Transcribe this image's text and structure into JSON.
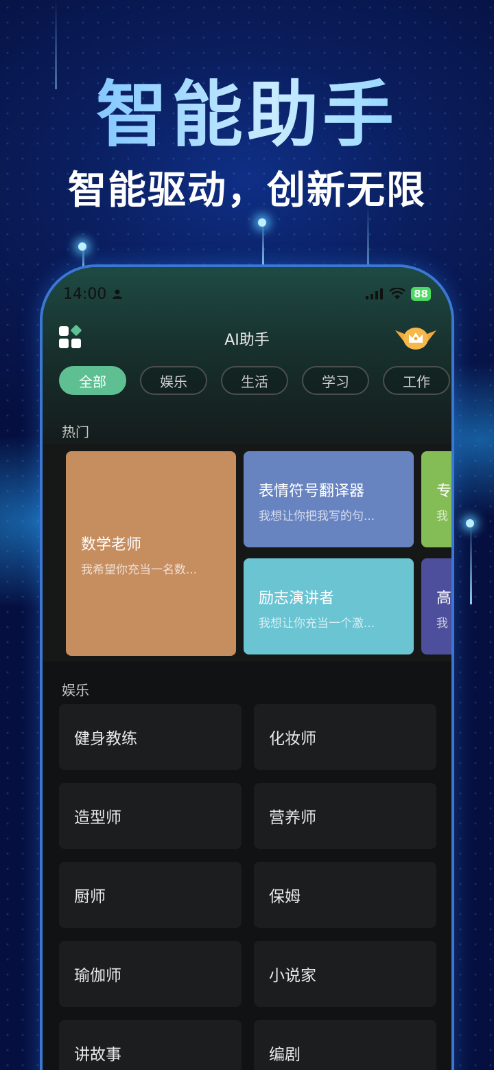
{
  "hero": {
    "title": "智能助手",
    "subtitle": "智能驱动，创新无限"
  },
  "status_bar": {
    "time": "14:00",
    "battery": "88"
  },
  "app": {
    "title": "AI助手"
  },
  "tabs": [
    {
      "label": "全部",
      "active": true
    },
    {
      "label": "娱乐"
    },
    {
      "label": "生活"
    },
    {
      "label": "学习"
    },
    {
      "label": "工作"
    }
  ],
  "hot": {
    "label": "热门",
    "cards": [
      {
        "title": "数学老师",
        "desc": "我希望你充当一名数...",
        "color": "#c68d5f"
      },
      {
        "title": "表情符号翻译器",
        "desc": "我想让你把我写的句...",
        "color": "#6884c0"
      },
      {
        "title": "励志演讲者",
        "desc": "我想让你充当一个激...",
        "color": "#6bc4d2"
      },
      {
        "title": "专",
        "desc": "我",
        "color": "#84bd55"
      },
      {
        "title": "高",
        "desc": "我",
        "color": "#4d4f9c"
      }
    ]
  },
  "entertainment": {
    "label": "娱乐",
    "items": [
      "健身教练",
      "化妆师",
      "造型师",
      "营养师",
      "厨师",
      "保姆",
      "瑜伽师",
      "小说家",
      "讲故事",
      "编剧"
    ]
  },
  "colors": {
    "accent": "#5ec092",
    "frame": "#3b78d6"
  }
}
